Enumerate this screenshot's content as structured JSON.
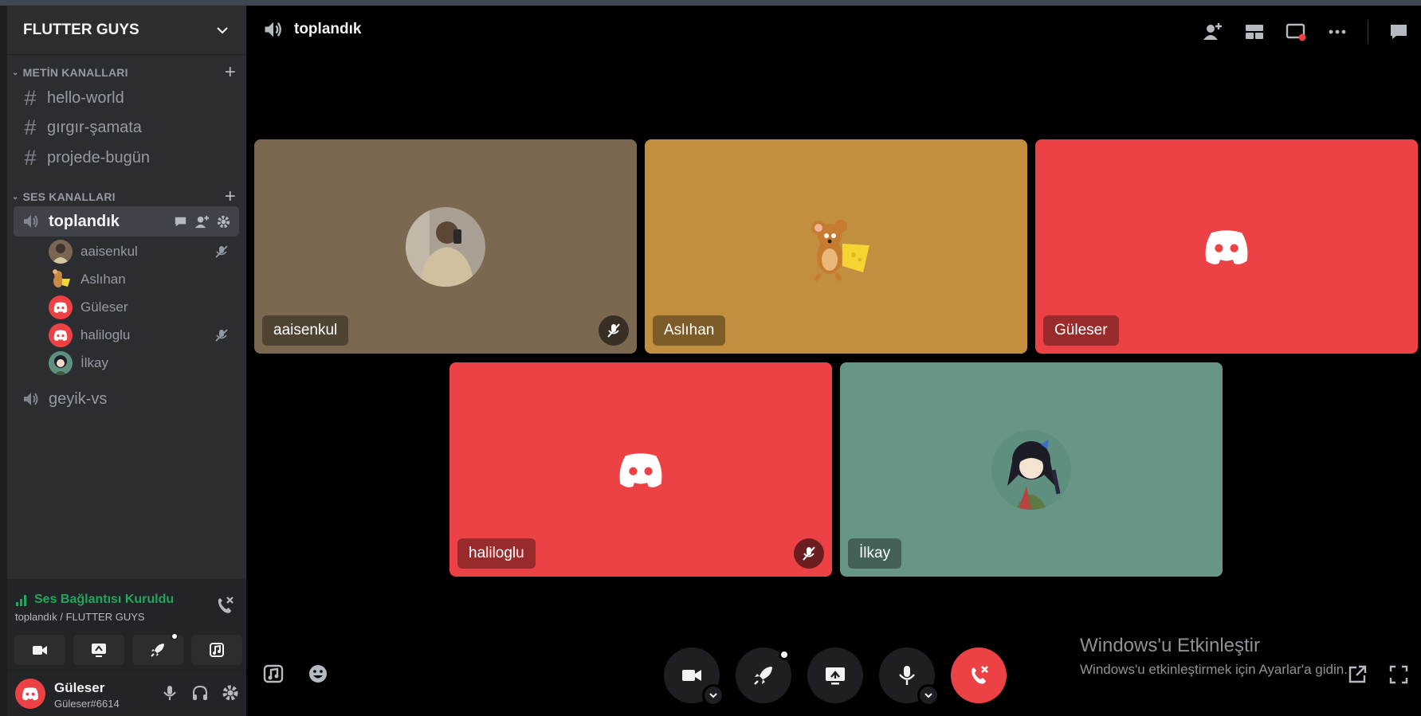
{
  "server": {
    "name": "FLUTTER GUYS"
  },
  "categories": {
    "text": "METİN KANALLARI",
    "voice": "SES KANALLARI"
  },
  "text_channels": [
    {
      "label": "hello-world"
    },
    {
      "label": "gırgır-şamata"
    },
    {
      "label": "projede-bugün"
    }
  ],
  "voice_channels": [
    {
      "label": "toplandık"
    },
    {
      "label": "geyik-vs"
    }
  ],
  "voice_users": [
    {
      "name": "aaisenkul",
      "muted": true
    },
    {
      "name": "Aslıhan",
      "muted": false
    },
    {
      "name": "Güleser",
      "muted": false
    },
    {
      "name": "haliloglu",
      "muted": true
    },
    {
      "name": "İlkay",
      "muted": false
    }
  ],
  "voice_status": {
    "status": "Ses Bağlantısı Kuruldu",
    "sub": "toplandık / FLUTTER GUYS"
  },
  "user": {
    "name": "Güleser",
    "tag": "Güleser#6614"
  },
  "main": {
    "title": "toplandık"
  },
  "tiles": [
    {
      "name": "aaisenkul",
      "color": "#7a6850",
      "muted": true
    },
    {
      "name": "Aslıhan",
      "color": "#c28e3f",
      "muted": false
    },
    {
      "name": "Güleser",
      "color": "#ed4245",
      "muted": false
    },
    {
      "name": "haliloglu",
      "color": "#ed4245",
      "muted": true
    },
    {
      "name": "İlkay",
      "color": "#689686",
      "muted": false
    }
  ],
  "watermark": {
    "title": "Windows'u Etkinleştir",
    "sub": "Windows'u etkinleştirmek için Ayarlar'a gidin."
  },
  "colors": {
    "green": "#23a55a",
    "red": "#ed4245",
    "sidebar": "#2b2d31"
  }
}
